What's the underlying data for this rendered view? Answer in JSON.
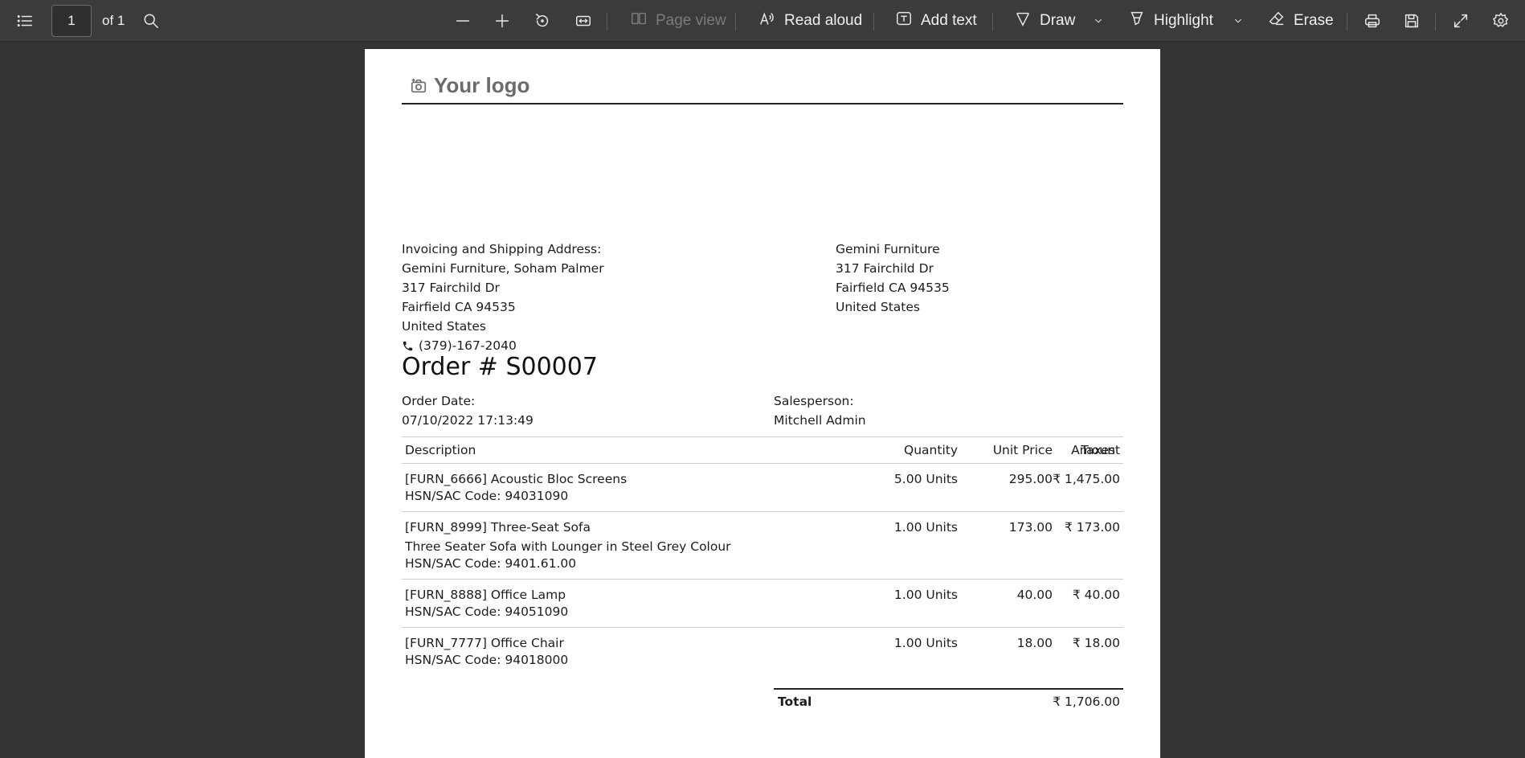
{
  "toolbar": {
    "page_current": "1",
    "page_total": "of 1",
    "page_view": "Page view",
    "read_aloud": "Read aloud",
    "add_text": "Add text",
    "draw": "Draw",
    "highlight": "Highlight",
    "erase": "Erase"
  },
  "document": {
    "logo_text": "Your logo",
    "invoice_address": {
      "heading": "Invoicing and Shipping Address:",
      "lines": [
        "Gemini Furniture, Soham Palmer",
        "317 Fairchild Dr",
        "Fairfield CA 94535",
        "United States"
      ],
      "phone": "(379)-167-2040"
    },
    "company_address": {
      "lines": [
        "Gemini Furniture",
        "317 Fairchild Dr",
        "Fairfield CA 94535",
        "United States"
      ]
    },
    "title": "Order # S00007",
    "order_date_label": "Order Date:",
    "order_date": "07/10/2022 17:13:49",
    "salesperson_label": "Salesperson:",
    "salesperson": "Mitchell Admin",
    "table": {
      "headers": [
        "Description",
        "Quantity",
        "Unit Price",
        "Taxes",
        "Amount"
      ],
      "rows": [
        {
          "name": "[FURN_6666] Acoustic Bloc Screens",
          "extra": "",
          "hsn": "HSN/SAC Code: 94031090",
          "qty": "5.00 Units",
          "price": "295.00",
          "taxes": "",
          "amount": "₹ 1,475.00"
        },
        {
          "name": "[FURN_8999] Three-Seat Sofa",
          "extra": "Three Seater Sofa with Lounger in Steel Grey Colour",
          "hsn": "HSN/SAC Code: 9401.61.00",
          "qty": "1.00 Units",
          "price": "173.00",
          "taxes": "",
          "amount": "₹ 173.00"
        },
        {
          "name": "[FURN_8888] Office Lamp",
          "extra": "",
          "hsn": "HSN/SAC Code: 94051090",
          "qty": "1.00 Units",
          "price": "40.00",
          "taxes": "",
          "amount": "₹ 40.00"
        },
        {
          "name": "[FURN_7777] Office Chair",
          "extra": "",
          "hsn": "HSN/SAC Code: 94018000",
          "qty": "1.00 Units",
          "price": "18.00",
          "taxes": "",
          "amount": "₹ 18.00"
        }
      ]
    },
    "total_label": "Total",
    "total_value": "₹ 1,706.00"
  }
}
